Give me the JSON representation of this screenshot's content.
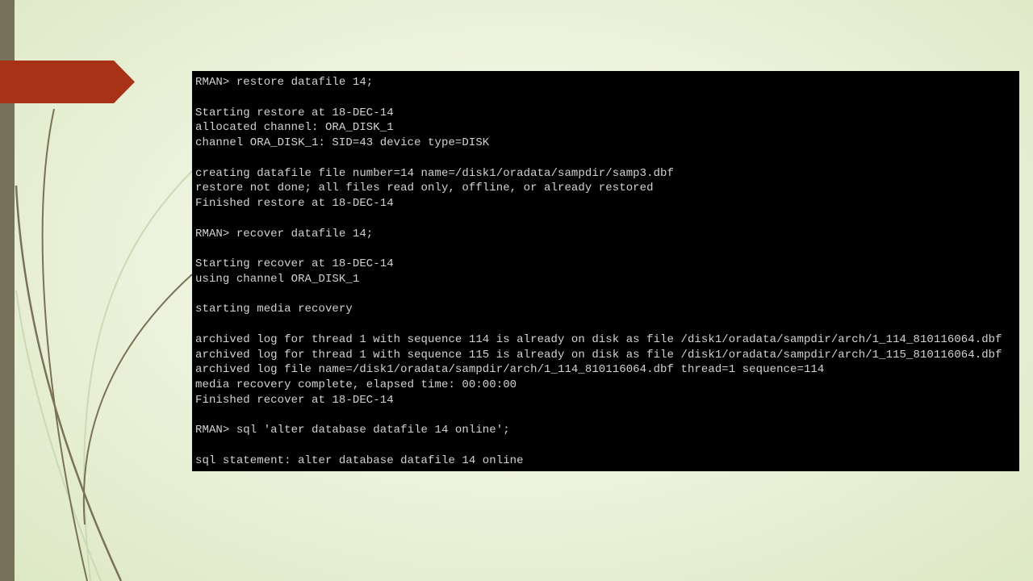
{
  "slide": {
    "background": "#eef3de",
    "left_bar_color": "#77705a",
    "accent_tab_color": "#a83216",
    "decor_line_color_dark": "#7a7256",
    "decor_line_color_light": "#cfd8b4"
  },
  "terminal": {
    "background": "#000000",
    "text_color": "#d2d2d2",
    "lines": [
      "RMAN> restore datafile 14;",
      "",
      "Starting restore at 18-DEC-14",
      "allocated channel: ORA_DISK_1",
      "channel ORA_DISK_1: SID=43 device type=DISK",
      "",
      "creating datafile file number=14 name=/disk1/oradata/sampdir/samp3.dbf",
      "restore not done; all files read only, offline, or already restored",
      "Finished restore at 18-DEC-14",
      "",
      "RMAN> recover datafile 14;",
      "",
      "Starting recover at 18-DEC-14",
      "using channel ORA_DISK_1",
      "",
      "starting media recovery",
      "",
      "archived log for thread 1 with sequence 114 is already on disk as file /disk1/oradata/sampdir/arch/1_114_810116064.dbf",
      "archived log for thread 1 with sequence 115 is already on disk as file /disk1/oradata/sampdir/arch/1_115_810116064.dbf",
      "archived log file name=/disk1/oradata/sampdir/arch/1_114_810116064.dbf thread=1 sequence=114",
      "media recovery complete, elapsed time: 00:00:00",
      "Finished recover at 18-DEC-14",
      "",
      "RMAN> sql 'alter database datafile 14 online';",
      "",
      "sql statement: alter database datafile 14 online"
    ]
  }
}
